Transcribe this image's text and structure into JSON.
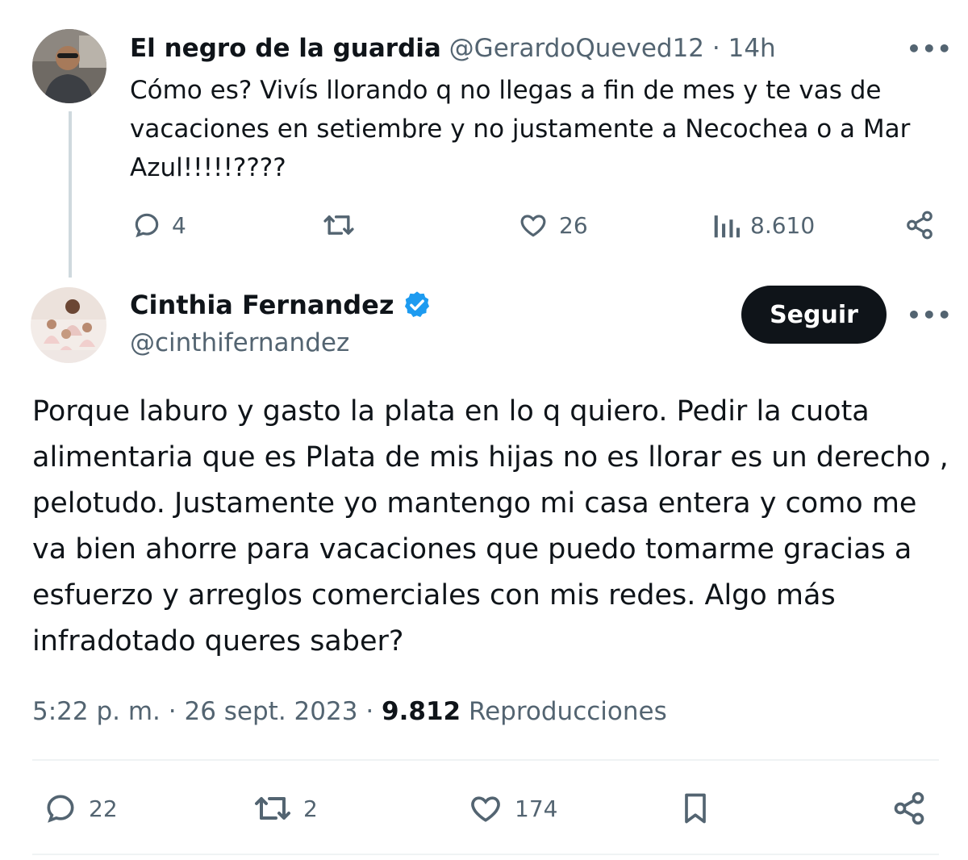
{
  "reply": {
    "display_name": "El negro de la guardia",
    "handle": "@GerardoQueved12",
    "separator": "·",
    "time": "14h",
    "text": "Cómo es? Vivís llorando q no llegas a fin de mes y te vas de vacaciones en setiembre y no justamente a Necochea o a Mar Azul!!!!!????",
    "more_label": "•••",
    "actions": {
      "replies": "4",
      "retweets": "",
      "likes": "26",
      "views": "8.610"
    }
  },
  "main": {
    "display_name": "Cinthia Fernandez",
    "verified": true,
    "handle": "@cinthifernandez",
    "follow_label": "Seguir",
    "more_label": "•••",
    "text": "Porque laburo y gasto la plata en lo q quiero. Pedir la cuota alimentaria que es Plata de mis hijas no es llorar es un derecho , pelotudo. Justamente yo mantengo mi casa entera y como me va bien ahorre para vacaciones que puedo tomarme gracias a esfuerzo y arreglos comerciales con mis redes. Algo más infradotado queres saber?",
    "meta": {
      "time": "5:22 p. m.",
      "sep1": "·",
      "date": "26 sept. 2023",
      "sep2": "·",
      "views_count": "9.812",
      "views_label": "Reproducciones"
    },
    "actions": {
      "replies": "22",
      "retweets": "2",
      "likes": "174"
    }
  },
  "colors": {
    "text": "#0f1419",
    "secondary": "#536471",
    "verified": "#1d9bf0",
    "button_bg": "#0f1419",
    "thread_line": "#cfd9de"
  },
  "icons": [
    "reply-icon",
    "retweet-icon",
    "like-icon",
    "views-icon",
    "share-icon",
    "bookmark-icon",
    "verified-badge-icon",
    "more-icon"
  ]
}
